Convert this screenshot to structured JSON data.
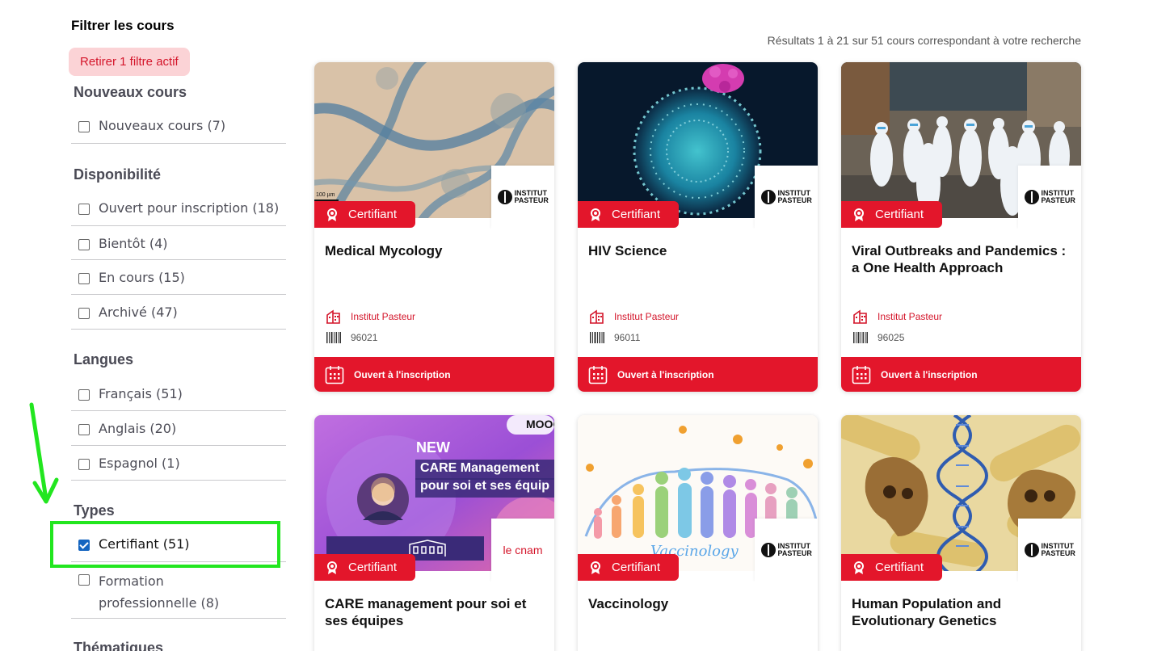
{
  "sidebar": {
    "title": "Filtrer les cours",
    "remove_filter": "Retirer 1 filtre actif",
    "facets": [
      {
        "title": "Nouveaux cours",
        "items": [
          {
            "label": "Nouveaux cours (7)",
            "checked": false
          }
        ]
      },
      {
        "title": "Disponibilité",
        "items": [
          {
            "label": "Ouvert pour inscription (18)",
            "checked": false
          },
          {
            "label": "Bientôt (4)",
            "checked": false
          },
          {
            "label": "En cours (15)",
            "checked": false
          },
          {
            "label": "Archivé (47)",
            "checked": false
          }
        ]
      },
      {
        "title": "Langues",
        "items": [
          {
            "label": "Français (51)",
            "checked": false
          },
          {
            "label": "Anglais (20)",
            "checked": false
          },
          {
            "label": "Espagnol (1)",
            "checked": false
          }
        ]
      },
      {
        "title": "Types",
        "items": [
          {
            "label": "Certifiant (51)",
            "checked": true
          },
          {
            "label": "Formation professionnelle (8)",
            "checked": false
          }
        ]
      },
      {
        "title": "Thématiques",
        "items": []
      }
    ]
  },
  "results": {
    "count_text": "Résultats 1 à 21 sur 51 cours correspondant à votre recherche",
    "cards": [
      {
        "title": "Medical Mycology",
        "badge": "Certifiant",
        "org": "Institut Pasteur",
        "code": "96021",
        "status": "Ouvert à l'inscription",
        "logo": "INSTITUT PASTEUR",
        "scale_label": "100 µm"
      },
      {
        "title": "HIV Science",
        "badge": "Certifiant",
        "org": "Institut Pasteur",
        "code": "96011",
        "status": "Ouvert à l'inscription",
        "logo": "INSTITUT PASTEUR"
      },
      {
        "title": "Viral Outbreaks and Pandemics : a One Health Approach",
        "badge": "Certifiant",
        "org": "Institut Pasteur",
        "code": "96025",
        "status": "Ouvert à l'inscription",
        "logo": "INSTITUT PASTEUR"
      },
      {
        "title": "CARE management pour soi et ses équipes",
        "badge": "Certifiant",
        "logo": "le cnam",
        "banner_new": "NEW",
        "banner_line1": "CARE Management",
        "banner_line2": "pour soi et ses équip",
        "banner_tag": "MOOC"
      },
      {
        "title": "Vaccinology",
        "badge": "Certifiant",
        "logo": "INSTITUT PASTEUR",
        "banner_word": "Vaccinology"
      },
      {
        "title": "Human Population and Evolutionary Genetics",
        "badge": "Certifiant",
        "logo": "INSTITUT PASTEUR"
      }
    ]
  },
  "colors": {
    "accent_red": "#e3162b",
    "filter_pill_bg": "#fbd3d6",
    "highlight_green": "#22e61f",
    "checkbox_blue": "#1565c0"
  }
}
